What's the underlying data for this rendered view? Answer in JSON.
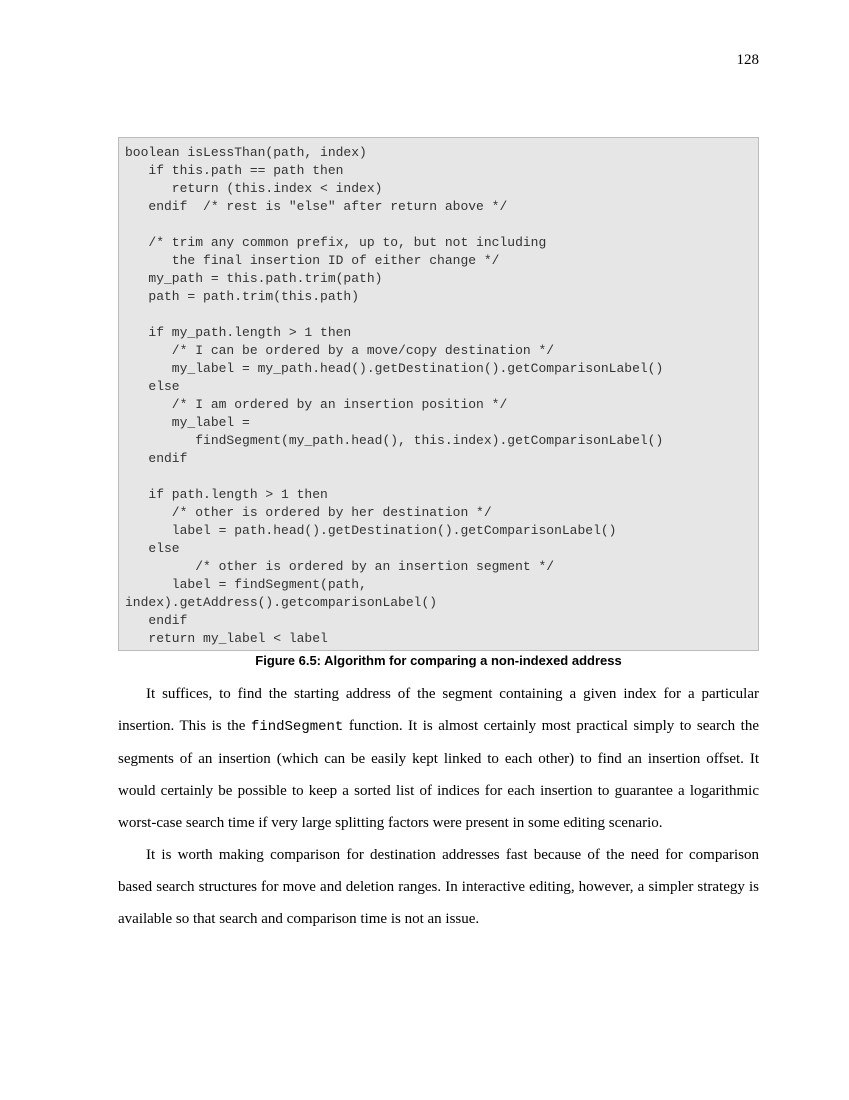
{
  "page_number": "128",
  "code_block": "boolean isLessThan(path, index)\n   if this.path == path then\n      return (this.index < index)\n   endif  /* rest is \"else\" after return above */\n\n   /* trim any common prefix, up to, but not including\n      the final insertion ID of either change */\n   my_path = this.path.trim(path)\n   path = path.trim(this.path)\n\n   if my_path.length > 1 then\n      /* I can be ordered by a move/copy destination */\n      my_label = my_path.head().getDestination().getComparisonLabel()\n   else\n      /* I am ordered by an insertion position */\n      my_label =\n         findSegment(my_path.head(), this.index).getComparisonLabel()\n   endif\n\n   if path.length > 1 then\n      /* other is ordered by her destination */\n      label = path.head().getDestination().getComparisonLabel()\n   else\n         /* other is ordered by an insertion segment */\n      label = findSegment(path,\nindex).getAddress().getcomparisonLabel()\n   endif\n   return my_label < label",
  "figure_caption": "Figure 6.5: Algorithm for comparing a non-indexed address",
  "paragraphs": {
    "p1_a": "It suffices, to find the starting address of the segment containing a given index for a particular insertion. This is the ",
    "p1_code": "findSegment",
    "p1_b": " function. It is almost certainly most practical simply to search the segments of an insertion (which can be easily kept linked to each other) to find an insertion offset. It would certainly be possible to keep a sorted list of indices for each insertion to guarantee a logarithmic worst-case search time if very large splitting factors were present in some editing scenario.",
    "p2": "It is worth making comparison for destination addresses fast because of the need for comparison based search structures for move and deletion ranges. In interactive editing, however, a simpler strategy is available so that search and comparison time is not an issue."
  }
}
